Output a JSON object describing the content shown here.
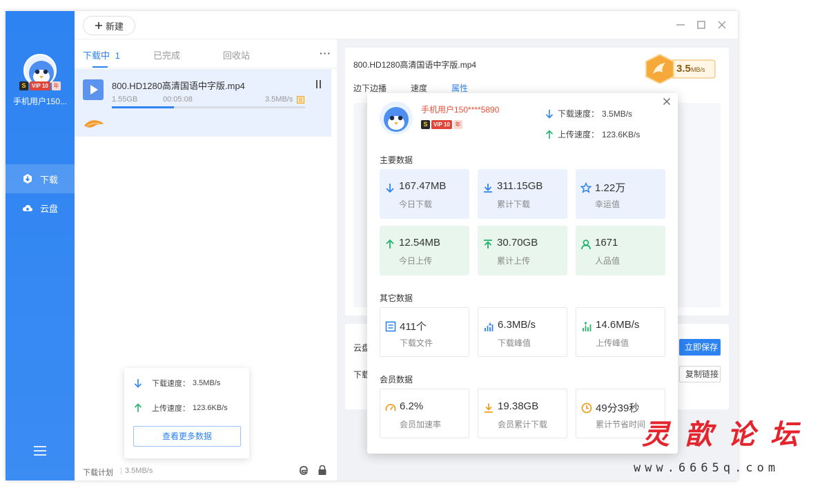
{
  "sidebar": {
    "user_name": "手机用户150...",
    "vip_badge": {
      "s": "S",
      "level": "VIP 10",
      "year": "年"
    },
    "nav": [
      {
        "label": "下载",
        "icon": "download-icon",
        "active": true
      },
      {
        "label": "云盘",
        "icon": "cloud-icon",
        "active": false
      }
    ],
    "menu_icon": "menu-icon"
  },
  "toolbar": {
    "new_label": "新建"
  },
  "tabs": {
    "downloading": "下载中",
    "downloading_count": "1",
    "completed": "已完成",
    "recycle": "回收站"
  },
  "task": {
    "name": "800.HD1280高清国语中字版.mp4",
    "size": "1.55GB",
    "remaining": "00:05:08",
    "speed": "3.5MB/s",
    "progress": 0.32
  },
  "bottom": {
    "plan_label": "下载计划",
    "speed": "3.5MB/s"
  },
  "speed_popup": {
    "download_label": "下载速度：",
    "download_value": "3.5MB/s",
    "upload_label": "上传速度：",
    "upload_value": "123.6KB/s",
    "more_button": "查看更多数据"
  },
  "detail": {
    "file_name": "800.HD1280高清国语中字版.mp4",
    "tabs": [
      "边下边播",
      "速度",
      "属性"
    ],
    "active_tab": 2,
    "speed_badge_value": "3.5",
    "speed_badge_unit": "MB/s",
    "cloud_label": "云盘",
    "download_label": "下载",
    "save_button": "立即保存",
    "copy_button": "复制链接"
  },
  "stats_popup": {
    "user_name": "手机用户150****5890",
    "download_speed_label": "下载速度：",
    "download_speed": "3.5MB/s",
    "upload_speed_label": "上传速度：",
    "upload_speed": "123.6KB/s",
    "main_section": "主要数据",
    "main": [
      {
        "value": "167.47MB",
        "label": "今日下载",
        "icon": "arrow-down-icon",
        "tone": "blue"
      },
      {
        "value": "311.15GB",
        "label": "累计下载",
        "icon": "arrow-down-bar-icon",
        "tone": "blue"
      },
      {
        "value": "1.22万",
        "label": "幸运值",
        "icon": "star-icon",
        "tone": "blue"
      },
      {
        "value": "12.54MB",
        "label": "今日上传",
        "icon": "arrow-up-icon",
        "tone": "green"
      },
      {
        "value": "30.70GB",
        "label": "累计上传",
        "icon": "arrow-up-bar-icon",
        "tone": "green"
      },
      {
        "value": "1671",
        "label": "人品值",
        "icon": "person-icon",
        "tone": "green"
      }
    ],
    "other_section": "其它数据",
    "other": [
      {
        "value": "411个",
        "label": "下载文件",
        "icon": "file-list-icon"
      },
      {
        "value": "6.3MB/s",
        "label": "下载峰值",
        "icon": "bars-down-icon"
      },
      {
        "value": "14.6MB/s",
        "label": "上传峰值",
        "icon": "bars-up-icon"
      }
    ],
    "member_section": "会员数据",
    "member": [
      {
        "value": "6.2%",
        "label": "会员加速率",
        "icon": "gauge-icon"
      },
      {
        "value": "19.38GB",
        "label": "会员累计下载",
        "icon": "download-tray-icon"
      },
      {
        "value": "49分39秒",
        "label": "累计节省时间",
        "icon": "clock-icon"
      }
    ]
  },
  "watermark": {
    "title": "灵歆论坛",
    "url": "www.6665q.com"
  },
  "colors": {
    "accent": "#2e83f2",
    "green": "#20b36a",
    "orange": "#f0a020",
    "vip_red": "#e0453a"
  }
}
